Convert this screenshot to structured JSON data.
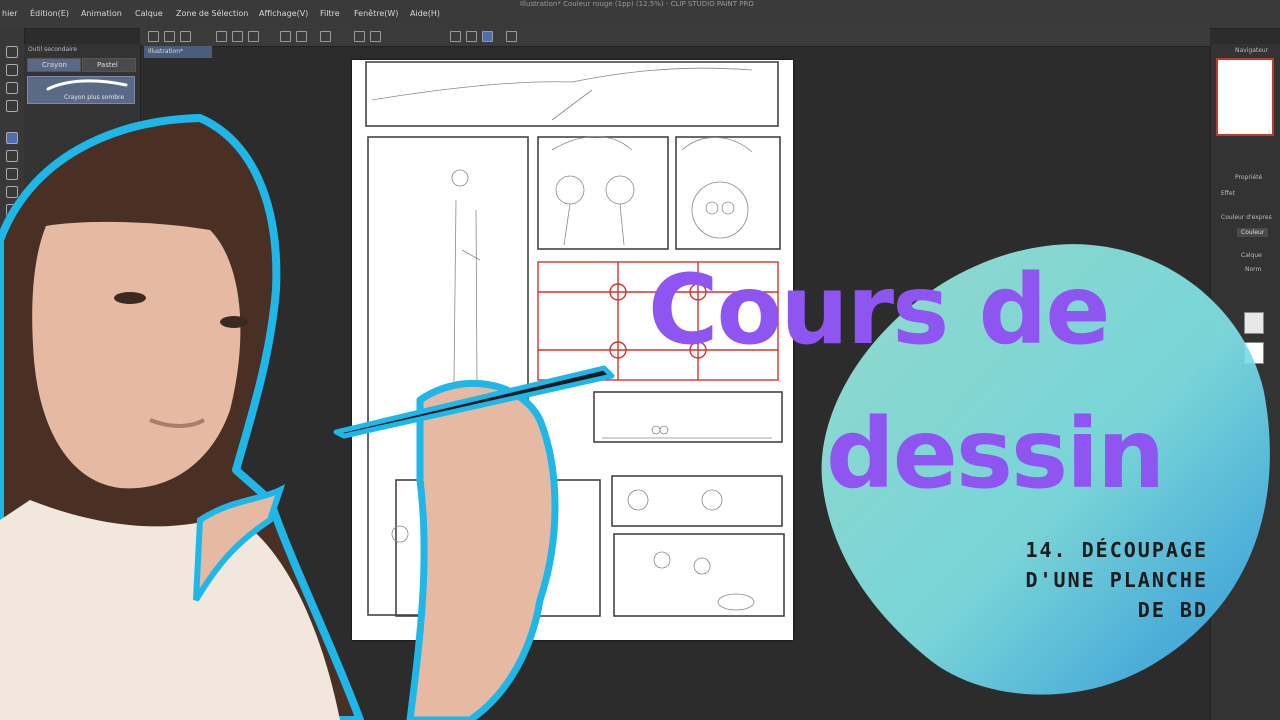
{
  "window": {
    "title": "Illustration* Couleur rouge (1pp) (12.5%) - CLIP STUDIO PAINT PRO"
  },
  "menu": [
    "hier",
    "Édition(E)",
    "Animation",
    "Calque",
    "Zone de Sélection",
    "Affichage(V)",
    "Filtre",
    "Fenêtre(W)",
    "Aide(H)"
  ],
  "subtool": {
    "header": "Outil secondaire",
    "tabs": [
      "Crayon",
      "Pastel"
    ],
    "brush_name": "Crayon plus sombre"
  },
  "document_tab": "Illustration*",
  "right_panel": {
    "navigator": "Navigateur",
    "properties": "Propriété",
    "effect": "Effet",
    "expression_color": "Couleur d'expres",
    "color_button": "Couleur",
    "layer": "Calque",
    "blend": "Norm"
  },
  "title": {
    "line1": "Cours de",
    "line2": "dessin"
  },
  "subtitle": {
    "line1": "14. DÉCOUPAGE",
    "line2": "D'UNE PLANCHE",
    "line3": "DE BD"
  },
  "colors": {
    "accent_purple": "#8f55f0",
    "outline_blue": "#1fb6e8",
    "panel_red": "#d9322b",
    "splash_cyan": "#5fdde4"
  }
}
